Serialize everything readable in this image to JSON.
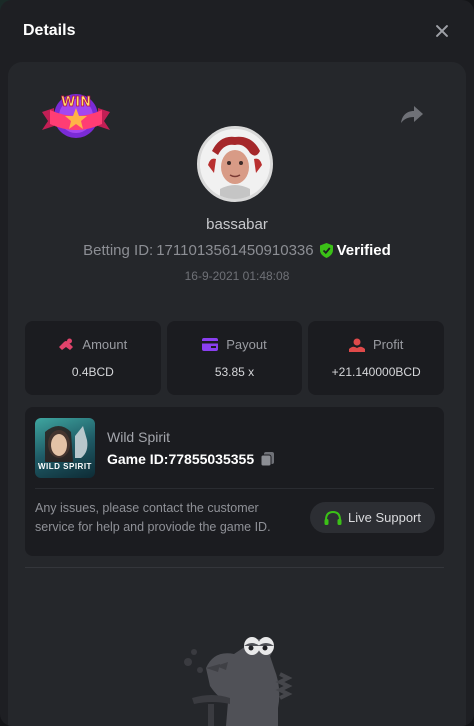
{
  "header": {
    "title": "Details"
  },
  "user": {
    "name": "bassabar"
  },
  "bet": {
    "betting_id_label": "Betting ID:",
    "betting_id": "1711013561450910336",
    "verified_label": "Verified",
    "timestamp": "16-9-2021 01:48:08"
  },
  "badge": {
    "text": "WIN"
  },
  "stats": [
    {
      "label": "Amount",
      "value": "0.4BCD",
      "icon": "amount-icon",
      "color": "#e0436b"
    },
    {
      "label": "Payout",
      "value": "53.85 x",
      "icon": "payout-card-icon",
      "color": "#8a3ff0"
    },
    {
      "label": "Profit",
      "value": "+21.140000BCD",
      "icon": "profit-icon",
      "color": "#e04a4a"
    }
  ],
  "game": {
    "name": "Wild Spirit",
    "game_id_label": "Game ID:",
    "game_id": "77855035355",
    "thumb_text": "WILD SPIRIT",
    "support_text": "Any issues, please contact the customer service for help and proviode the game ID.",
    "live_support_label": "Live Support"
  },
  "colors": {
    "verified": "#3bc117",
    "live_support_icon": "#3bc117",
    "background": "#1e1f23",
    "card": "#25272b"
  }
}
